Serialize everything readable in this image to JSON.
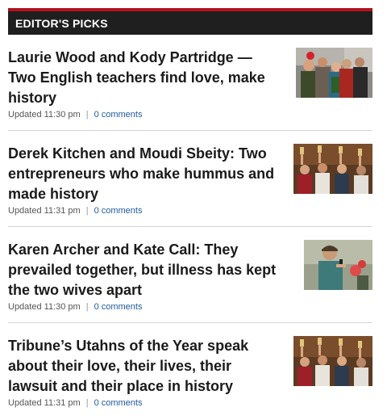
{
  "header": {
    "title": "EDITOR'S PICKS"
  },
  "stories": [
    {
      "headline": "Laurie Wood and Kody Partridge — Two English teachers find love, make history",
      "updated": "Updated 11:30 pm",
      "separator": "|",
      "comments": "0 comments"
    },
    {
      "headline": "Derek Kitchen and Moudi Sbeity: Two entrepreneurs who make hummus and made history",
      "updated": "Updated 11:31 pm",
      "separator": "|",
      "comments": "0 comments"
    },
    {
      "headline": "Karen Archer and Kate Call: They prevailed together, but illness has kept the two wives apart",
      "updated": "Updated 11:30 pm",
      "separator": "|",
      "comments": "0 comments"
    },
    {
      "headline": "Tribune’s Utahns of the Year speak about their love, their lives, their lawsuit and their place in history",
      "updated": "Updated 11:31 pm",
      "separator": "|",
      "comments": "0 comments"
    }
  ],
  "colors": {
    "accent": "#b3121a",
    "header_bg": "#1f1f1f",
    "link": "#1e5a9e"
  }
}
